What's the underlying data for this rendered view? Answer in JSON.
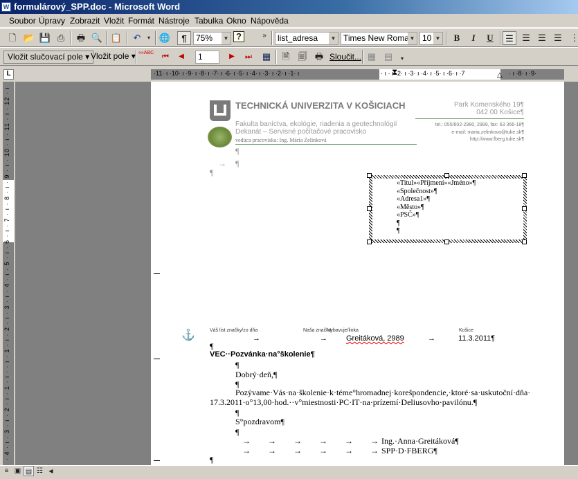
{
  "window": {
    "title": "formulárový_SPP.doc - Microsoft Word",
    "icon": "W"
  },
  "menu": [
    "Soubor",
    "Úpravy",
    "Zobrazit",
    "Vložit",
    "Formát",
    "Nástroje",
    "Tabulka",
    "Okno",
    "Nápověda"
  ],
  "toolbar": {
    "zoom": "75%",
    "style": "list_adresa",
    "font": "Times New Roman",
    "size": "10",
    "bold": "B",
    "italic": "I",
    "underline": "U",
    "pilcrow": "¶",
    "help": "?"
  },
  "mailmerge": {
    "insert_merge_field": "Vložit slučovací pole",
    "insert_field": "Vložit pole",
    "record": "1",
    "merge": "Sloučit...",
    "abc": "«»ABC"
  },
  "ruler": {
    "ticks_left": "·11· ı ·10· ı ·9· ı ·8· ı ·7· ı ·6· ı ·5· ı ·4· ı ·3· ı ·2· ı ·1· ı",
    "ticks_right": "· ı · ı ·2· ı ·3· ı ·4· ı ·5· ı ·6· ı ·7",
    "ticks_far": "· ı ·8· ı ·9·",
    "vertical": "· 4 · ı · 3 · ı · 2 · ı · 1 · ı ·   · ı · 1 · ı · 2 · ı · 3 · ı · 4 · ı · 5 · ı · 6 · ı · 7 · ı · 8 · ı · 9 · ı · 10 · ı · 11 · ı · 12 · ı · 13 · ı · 14 ·"
  },
  "letterhead": {
    "university": "TECHNICKÁ UNIVERZITA V KOŠICIACH",
    "street": "Park Komenského 19¶",
    "city": "042 00 Košice¶",
    "faculty": "Fakulta baníctva, ekológie, riadenia a geotechnológií",
    "dept": "Dekanát – Servisné počítačové pracovisko",
    "head": "vedúca pracoviska: Ing. Mária Zelinková",
    "phone": "tel.: 055/602-2980, 2989, fax: 63 366-18¶",
    "email": "e-mail: maria.zelinkova@tuke.sk¶",
    "web": "http://www.fberg.tuke.sk¶"
  },
  "address_fields": [
    "«Titul»«Příjmení»«Jméno»¶",
    "«Společnost»¶",
    "«Adresa1»¶",
    "«Město»¶",
    "«PSČ»¶",
    "¶",
    "¶"
  ],
  "ref": {
    "your_letter": "Váš list značky/zo dňa",
    "our_ref": "Naša značka",
    "handled_by": "Vybavuje/linka",
    "place": "Košice",
    "handler": "Greitáková, 2989",
    "date": "11.3.2011¶"
  },
  "body": {
    "subject": "VEC··Pozvánka·na°školenie¶",
    "greeting": "Dobrý·deň,¶",
    "p1a": "Pozývame·Vás·na·školenie·k·téme°hromadnej·korešpondencie,·ktoré·sa·uskutoční·dňa·",
    "p1b": "17.3.2011·o°13,00·hod.··v°miestnosti·PC·IT·na·prízemí·Deliusovho·pavilónu.¶",
    "closing": "S°pozdravom¶",
    "name": "Ing.·Anna·Greitáková¶",
    "org": "SPP·D·FBERG¶",
    "pilcrow": "¶"
  }
}
